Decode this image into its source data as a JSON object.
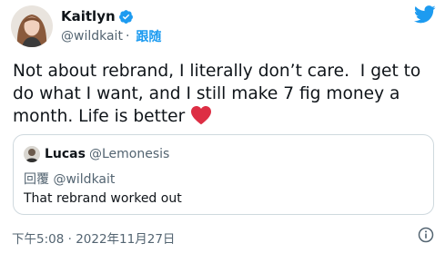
{
  "author": {
    "name": "Kaitlyn",
    "handle": "@wildkait",
    "separator": "·",
    "follow_label": "跟随"
  },
  "tweet": {
    "text": "Not about rebrand, I literally don’t care.  I get to do what I want, and I still make 7 fig money a month. Life is better "
  },
  "quote": {
    "name": "Lucas",
    "handle": "@Lemonesis",
    "reply_label": "回覆",
    "reply_to": "@wildkait",
    "text": "That rebrand worked out"
  },
  "footer": {
    "timestamp": "下午5:08 · 2022年11月27日"
  },
  "colors": {
    "accent": "#1d9bf0",
    "heart": "#f91880",
    "muted": "#536471",
    "border": "#cfd9de"
  },
  "icons": [
    "verified-badge-icon",
    "twitter-bird-icon",
    "red-heart-emoji-icon",
    "info-icon"
  ]
}
